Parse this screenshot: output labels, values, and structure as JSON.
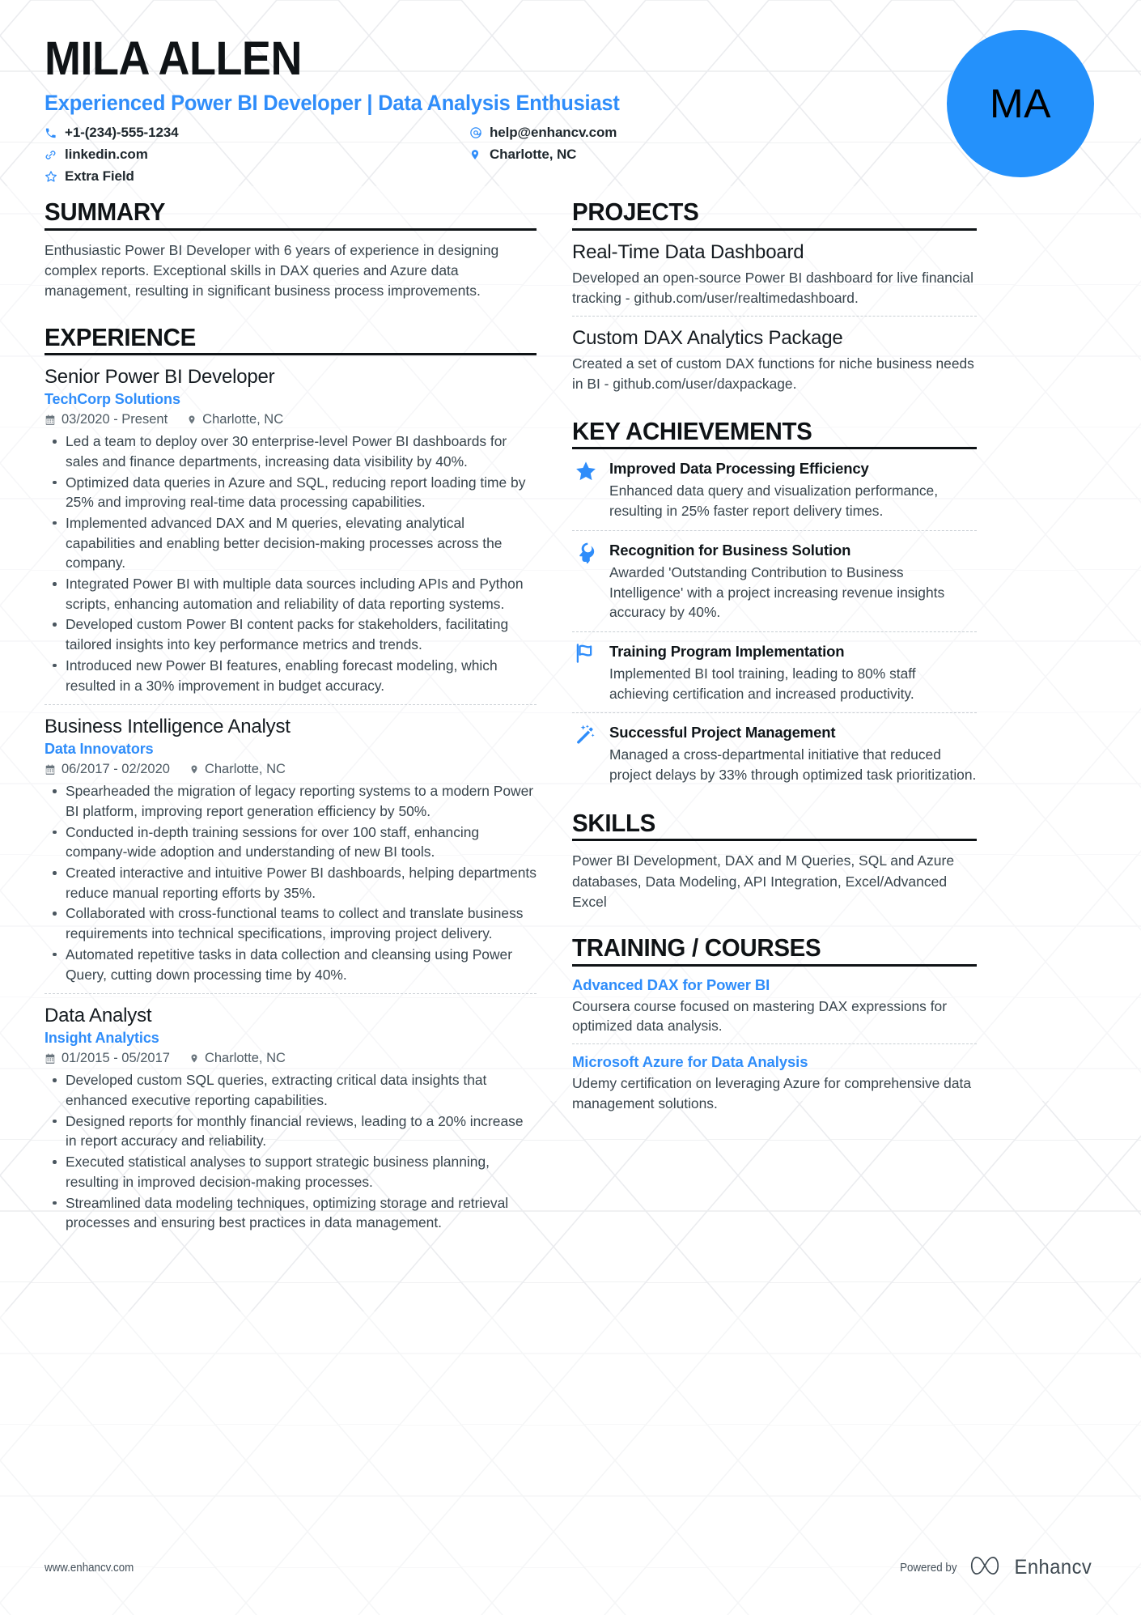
{
  "colors": {
    "accent": "#2f8dfa",
    "avatar_bg": "#2491fb",
    "heading": "#0f1316",
    "text": "#39454d",
    "rule": "#0f1316"
  },
  "header": {
    "name": "MILA ALLEN",
    "headline": "Experienced Power BI Developer | Data Analysis Enthusiast",
    "avatar_initials": "MA",
    "contacts": [
      {
        "icon": "phone-icon",
        "value": "+1-(234)-555-1234"
      },
      {
        "icon": "email-icon",
        "value": "help@enhancv.com"
      },
      {
        "icon": "link-icon",
        "value": "linkedin.com"
      },
      {
        "icon": "location-icon",
        "value": "Charlotte, NC"
      },
      {
        "icon": "star-icon",
        "value": "Extra Field"
      }
    ]
  },
  "left": {
    "summary": {
      "title": "SUMMARY",
      "text": "Enthusiastic Power BI Developer with 6 years of experience in designing complex reports. Exceptional skills in DAX queries and Azure data management, resulting in significant business process improvements."
    },
    "experience": {
      "title": "EXPERIENCE",
      "entries": [
        {
          "role": "Senior Power BI Developer",
          "company": "TechCorp Solutions",
          "dates": "03/2020 - Present",
          "location": "Charlotte, NC",
          "bullets": [
            "Led a team to deploy over 30 enterprise-level Power BI dashboards for sales and finance departments, increasing data visibility by 40%.",
            "Optimized data queries in Azure and SQL, reducing report loading time by 25% and improving real-time data processing capabilities.",
            "Implemented advanced DAX and M queries, elevating analytical capabilities and enabling better decision-making processes across the company.",
            "Integrated Power BI with multiple data sources including APIs and Python scripts, enhancing automation and reliability of data reporting systems.",
            "Developed custom Power BI content packs for stakeholders, facilitating tailored insights into key performance metrics and trends.",
            "Introduced new Power BI features, enabling forecast modeling, which resulted in a 30% improvement in budget accuracy."
          ]
        },
        {
          "role": "Business Intelligence Analyst",
          "company": "Data Innovators",
          "dates": "06/2017 - 02/2020",
          "location": "Charlotte, NC",
          "bullets": [
            "Spearheaded the migration of legacy reporting systems to a modern Power BI platform, improving report generation efficiency by 50%.",
            "Conducted in-depth training sessions for over 100 staff, enhancing company-wide adoption and understanding of new BI tools.",
            "Created interactive and intuitive Power BI dashboards, helping departments reduce manual reporting efforts by 35%.",
            "Collaborated with cross-functional teams to collect and translate business requirements into technical specifications, improving project delivery.",
            "Automated repetitive tasks in data collection and cleansing using Power Query, cutting down processing time by 40%."
          ]
        },
        {
          "role": "Data Analyst",
          "company": "Insight Analytics",
          "dates": "01/2015 - 05/2017",
          "location": "Charlotte, NC",
          "bullets": [
            "Developed custom SQL queries, extracting critical data insights that enhanced executive reporting capabilities.",
            "Designed reports for monthly financial reviews, leading to a 20% increase in report accuracy and reliability.",
            "Executed statistical analyses to support strategic business planning, resulting in improved decision-making processes.",
            "Streamlined data modeling techniques, optimizing storage and retrieval processes and ensuring best practices in data management."
          ]
        }
      ]
    }
  },
  "right": {
    "projects": {
      "title": "PROJECTS",
      "entries": [
        {
          "name": "Real-Time Data Dashboard",
          "description": "Developed an open-source Power BI dashboard for live financial tracking - github.com/user/realtimedashboard."
        },
        {
          "name": "Custom DAX Analytics Package",
          "description": "Created a set of custom DAX functions for niche business needs in BI - github.com/user/daxpackage."
        }
      ]
    },
    "achievements": {
      "title": "KEY ACHIEVEMENTS",
      "entries": [
        {
          "icon": "star-filled-icon",
          "title": "Improved Data Processing Efficiency",
          "description": "Enhanced data query and visualization performance, resulting in 25% faster report delivery times."
        },
        {
          "icon": "head-brain-icon",
          "title": "Recognition for Business Solution",
          "description": "Awarded 'Outstanding Contribution to Business Intelligence' with a project increasing revenue insights accuracy by 40%."
        },
        {
          "icon": "flag-icon",
          "title": "Training Program Implementation",
          "description": "Implemented BI tool training, leading to 80% staff achieving certification and increased productivity."
        },
        {
          "icon": "magic-wand-icon",
          "title": "Successful Project Management",
          "description": "Managed a cross-departmental initiative that reduced project delays by 33% through optimized task prioritization."
        }
      ]
    },
    "skills": {
      "title": "SKILLS",
      "text": "Power BI Development, DAX and M Queries, SQL and Azure databases, Data Modeling, API Integration, Excel/Advanced Excel"
    },
    "training": {
      "title": "TRAINING / COURSES",
      "entries": [
        {
          "name": "Advanced DAX for Power BI",
          "description": "Coursera course focused on mastering DAX expressions for optimized data analysis."
        },
        {
          "name": "Microsoft Azure for Data Analysis",
          "description": "Udemy certification on leveraging Azure for comprehensive data management solutions."
        }
      ]
    }
  },
  "footer": {
    "website": "www.enhancv.com",
    "powered_by": "Powered by",
    "brand": "Enhancv"
  }
}
